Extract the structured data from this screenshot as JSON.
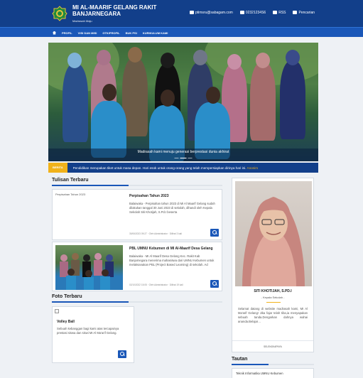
{
  "header": {
    "title_line1": "MI AL-MAARIF GELANG RAKIT",
    "title_line2": "BANJARNEGARA",
    "subtitle": "Madrasah Maju",
    "email": "ptimsru@sabagam.com",
    "phone": "02321234S6",
    "rss": "RSS",
    "register": "Pencarian"
  },
  "nav": {
    "items": [
      "PROFIL",
      "VISI DAN MISI",
      "GTK/PROFIL",
      "BUK PSI",
      "KURIKULUM KAMI"
    ]
  },
  "hero": {
    "caption": "Madrasah kami menuju generasi berprestasi dunia akhirat"
  },
  "ticker": {
    "label": "BERITA",
    "text": "Pendidikan merupakan tiket untuk masa depan. Hari esok untuk orang-orang yang telah mempersiapkan dirinya hari ini.",
    "author": "Anonim"
  },
  "sections": {
    "posts_title": "Tulisan Terbaru",
    "photos_title": "Foto Terbaru",
    "links_title": "Tautan"
  },
  "posts": [
    {
      "thumb_alt": "Perpisahan Tahun 2023",
      "title": "Perpisahan Tahun 2023",
      "excerpt": "Balaiwaka - Perpisahan tahun 2023 di Mi Al Maarif Gelang sudah dilakukan tanggal 30 Juni 2023 di sekolah, dihandi oleh Kepala Sekolah Siti Khotijah, S.Pd.I beserta",
      "meta": "30/06/2023 09:27 · Oleh Administrator · Dilihat 3 kali"
    },
    {
      "title": "PBL UMNU Kebumen di MI Al-Maarif Desa Gelang",
      "excerpt": "Balaiwaka - MI Al Maarif Desa Gelang Kec. Rakit Kab Banjarnegara menerima mahasiswa dari UMNU Kebumen untuk melaksanakan PBL (Project Based Learning) di sekolah. Ad",
      "meta": "02/10/2022 15:05 · Oleh Administrator · Dilihat 19 kali"
    }
  ],
  "photo": {
    "title": "Volley Ball",
    "text": "Sebuah kebanggan bagi kami atas tercapainya prestasi siswa dan siswi MI Al Ma'arif Gelang."
  },
  "profile": {
    "name": "SITI KHOTIJAH, S.PD.I",
    "role": "- Kepala Sekolah -",
    "text": "Selamat datang di website madrasah kami, MI Al Ma'arif Gelang! Jika fajar telah tiba,ia menyapakan sebuah tanda.Dengarkan dahnya wahai ananda.Belajar…",
    "footer": "SELENGKAPNYA"
  },
  "links": {
    "first": "Teknik Informatika UMNU Kebumen"
  },
  "colors": {
    "primary": "#123f8a",
    "nav": "#1a57b8",
    "accent": "#f1b21a"
  }
}
